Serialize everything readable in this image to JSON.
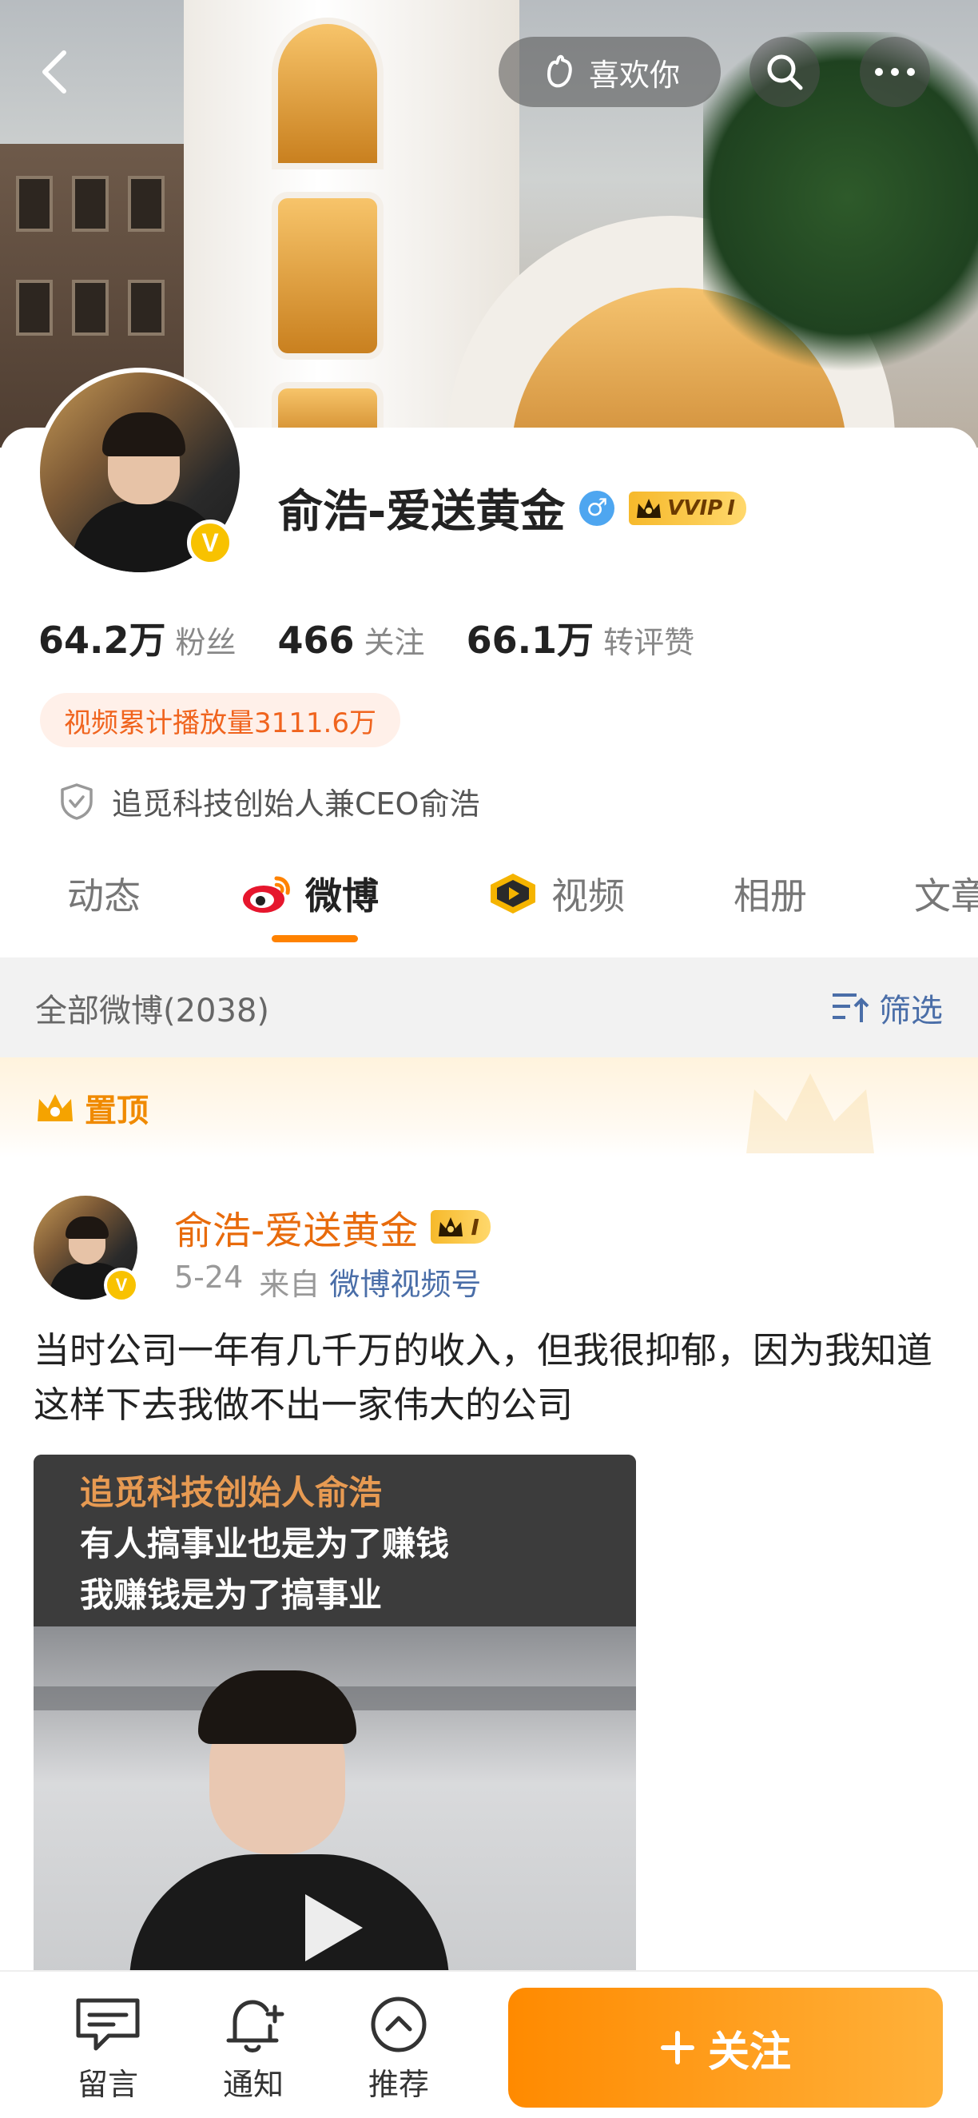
{
  "header": {
    "like_label": "喜欢你"
  },
  "profile": {
    "name": "俞浩-爱送黄金",
    "vip_label": "VVIP",
    "vip_level": "Ⅰ",
    "verified_mark": "V",
    "gender_symbol": "♂",
    "stats": [
      {
        "value": "64.2万",
        "label": "粉丝"
      },
      {
        "value": "466",
        "label": "关注"
      },
      {
        "value": "66.1万",
        "label": "转评赞"
      }
    ],
    "play_count": "视频累计播放量3111.6万",
    "certification": "追觅科技创始人兼CEO俞浩"
  },
  "tabs": [
    {
      "label": "动态"
    },
    {
      "label": "微博"
    },
    {
      "label": "视频"
    },
    {
      "label": "相册"
    },
    {
      "label": "文章"
    }
  ],
  "feed": {
    "count_label": "全部微博(2038)",
    "filter_label": "筛选",
    "pinned_label": "置顶"
  },
  "post": {
    "author": "俞浩-爱送黄金",
    "level": "Ⅰ",
    "date": "5-24",
    "from_label": "来自",
    "source": "微博视频号",
    "text": "当时公司一年有几千万的收入，但我很抑郁，因为我知道这样下去我做不出一家伟大的公司",
    "video": {
      "line1": "追觅科技创始人俞浩",
      "line2": "有人搞事业也是为了赚钱",
      "line3": "我赚钱是为了搞事业"
    }
  },
  "bottom_bar": {
    "message": "留言",
    "notify": "通知",
    "recommend": "推荐",
    "follow": "关注"
  },
  "colors": {
    "accent_orange": "#ff8200",
    "link_blue": "#4a6ea8",
    "verified_yellow": "#f8c200"
  }
}
